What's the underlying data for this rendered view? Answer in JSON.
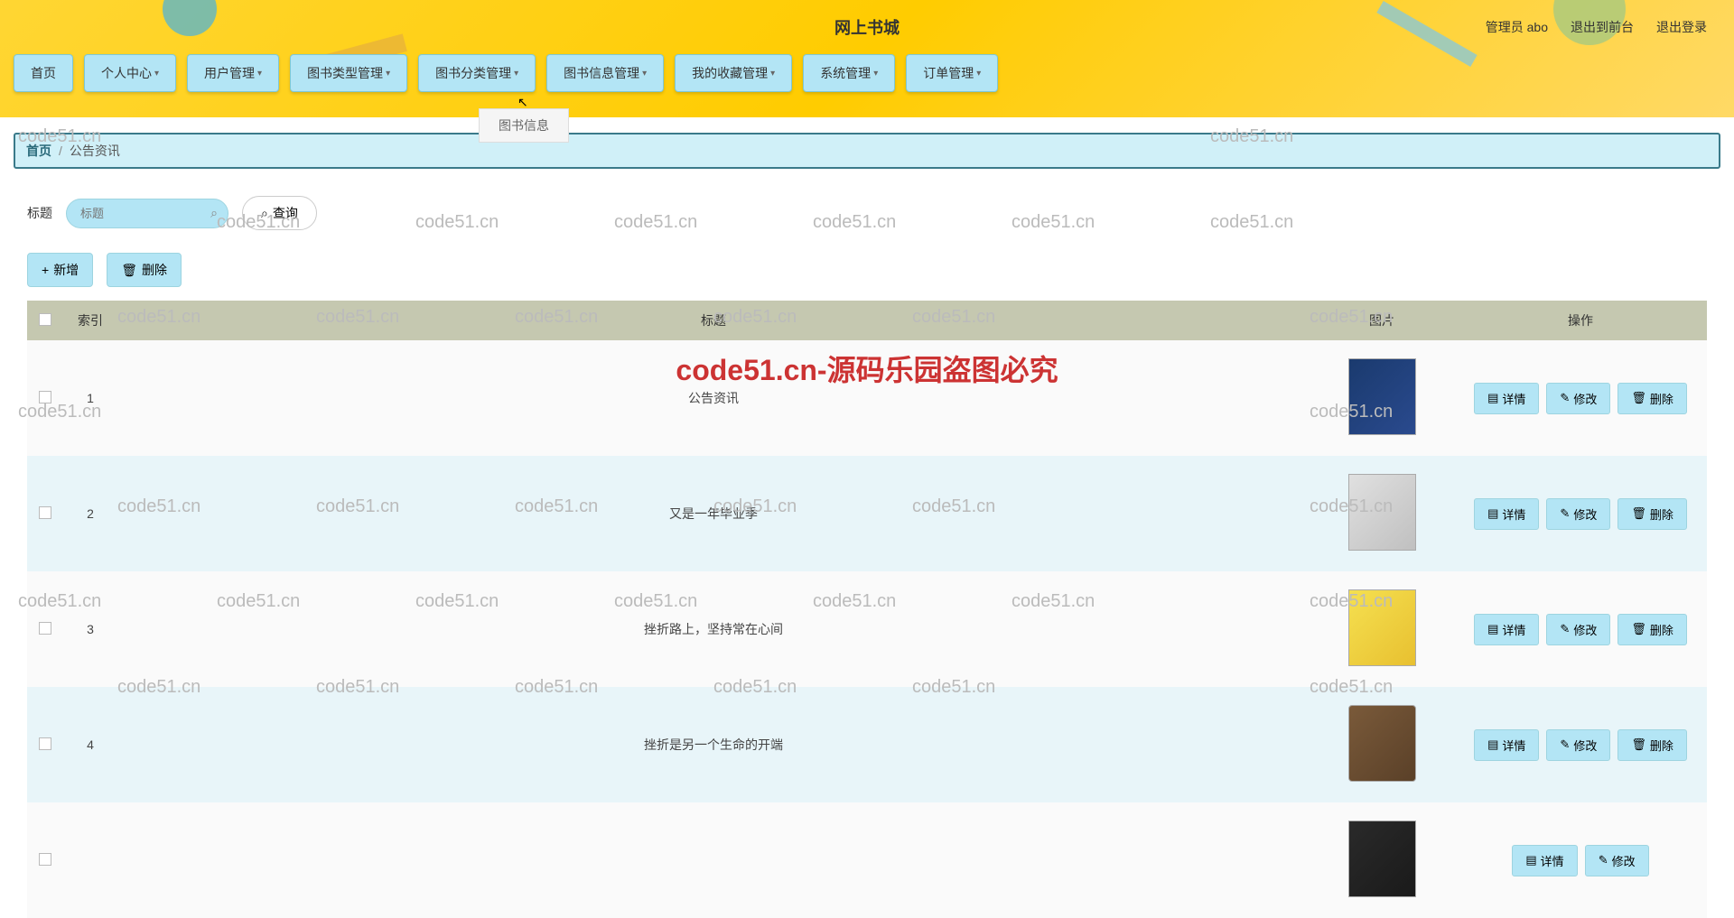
{
  "header": {
    "title": "网上书城",
    "admin_label": "管理员 abo",
    "back_to_front": "退出到前台",
    "logout": "退出登录"
  },
  "nav": {
    "items": [
      {
        "label": "首页",
        "has_dropdown": false
      },
      {
        "label": "个人中心",
        "has_dropdown": true
      },
      {
        "label": "用户管理",
        "has_dropdown": true
      },
      {
        "label": "图书类型管理",
        "has_dropdown": true
      },
      {
        "label": "图书分类管理",
        "has_dropdown": true
      },
      {
        "label": "图书信息管理",
        "has_dropdown": true
      },
      {
        "label": "我的收藏管理",
        "has_dropdown": true
      },
      {
        "label": "系统管理",
        "has_dropdown": true
      },
      {
        "label": "订单管理",
        "has_dropdown": true
      }
    ],
    "dropdown_item": "图书信息"
  },
  "breadcrumb": {
    "home": "首页",
    "sep": "/",
    "current": "公告资讯"
  },
  "filter": {
    "label": "标题",
    "placeholder": "标题",
    "query_label": "查询"
  },
  "actions": {
    "add_label": "新增",
    "delete_label": "删除"
  },
  "table": {
    "headers": {
      "index": "索引",
      "title": "标题",
      "image": "图片",
      "action": "操作"
    },
    "row_buttons": {
      "detail": "详情",
      "edit": "修改",
      "delete": "删除"
    },
    "rows": [
      {
        "index": "1",
        "title": "公告资讯"
      },
      {
        "index": "2",
        "title": "又是一年毕业季"
      },
      {
        "index": "3",
        "title": "挫折路上，坚持常在心间"
      },
      {
        "index": "4",
        "title": "挫折是另一个生命的开端"
      }
    ]
  },
  "watermark": {
    "text": "code51.cn",
    "center": "code51.cn-源码乐园盗图必究"
  }
}
